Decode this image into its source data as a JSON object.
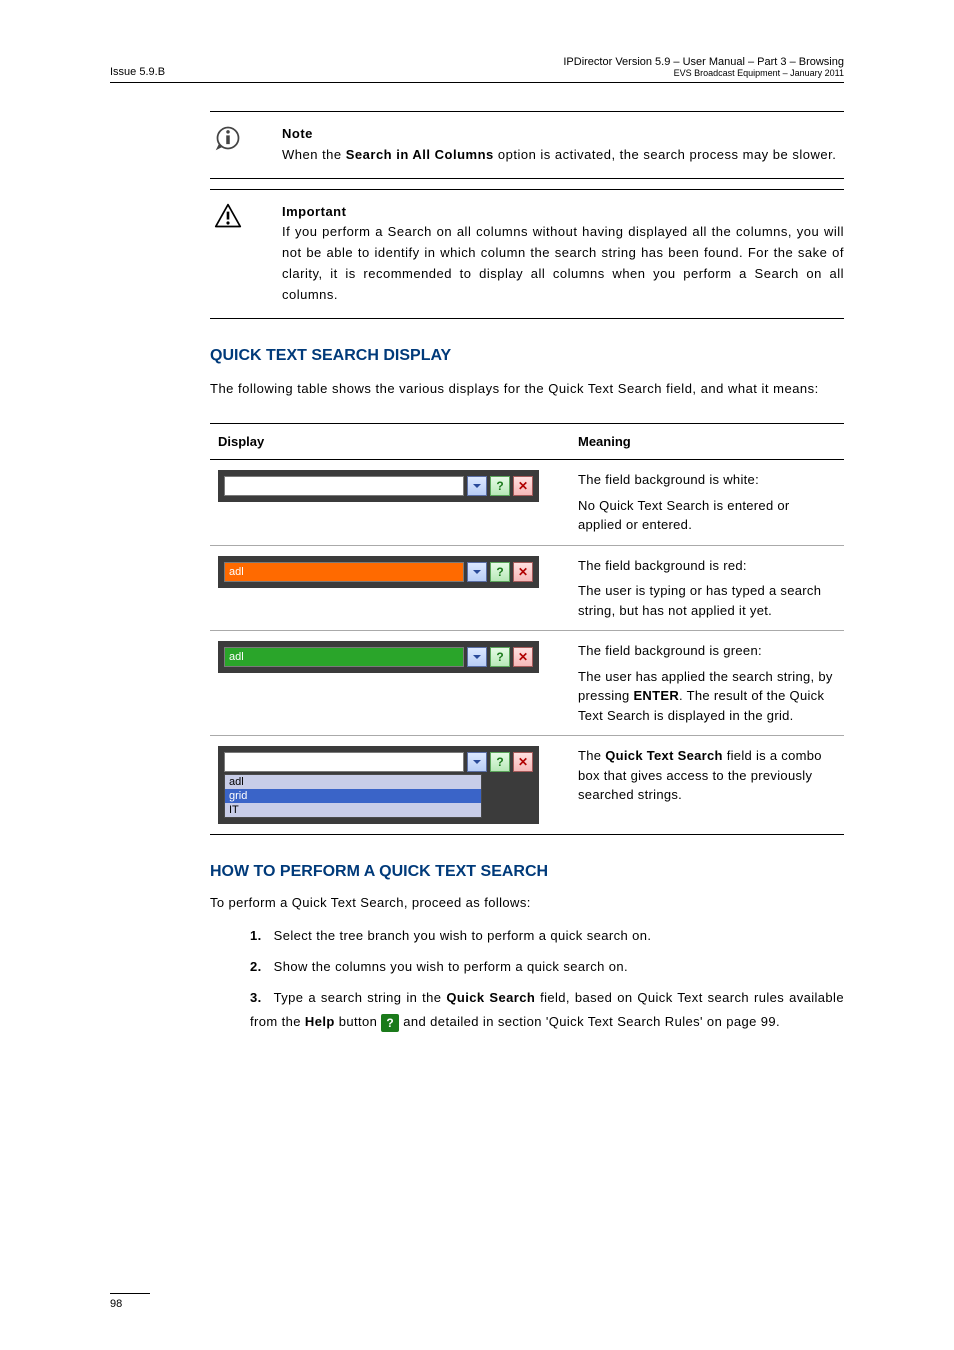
{
  "header": {
    "left": "Issue 5.9.B",
    "right_main": "IPDirector Version 5.9 – User Manual – Part 3 – Browsing",
    "right_sub": "EVS Broadcast Equipment – January 2011"
  },
  "note": {
    "title": "Note",
    "text_before": "When the ",
    "bold1": "Search in All Columns",
    "text_after": " option is activated, the search process may be slower."
  },
  "warning": {
    "title": "Important",
    "text": "If you perform a Search on all columns without having displayed all the columns, you will not be able to identify in which column the search string has been found. For the sake of clarity, it is recommended to display all columns when you perform a Search on all columns."
  },
  "section1": {
    "title": "QUICK TEXT SEARCH DISPLAY",
    "intro": "The following table shows the various displays for the Quick Text Search field, and what it means:",
    "table": {
      "headers": {
        "col1": "Display",
        "col2": "Meaning"
      },
      "rows": [
        {
          "field_bg": "white",
          "field_text": "",
          "show_dropdown": false,
          "meaning_line1": "The field background is white:",
          "meaning_line2": "No Quick Text Search is entered or applied or entered."
        },
        {
          "field_bg": "red",
          "field_text": "adl",
          "show_dropdown": false,
          "meaning_line1": "The field background is red:",
          "meaning_line2": "The user is typing or has typed a search string, but has not applied it yet."
        },
        {
          "field_bg": "green",
          "field_text": "adl",
          "show_dropdown": false,
          "meaning_line1": "The field background is green:",
          "meaning_line2a": "The user has applied the search string, by pressing ",
          "meaning_bold": "ENTER",
          "meaning_line2b": ". The result of the Quick Text Search is displayed in the grid."
        },
        {
          "field_bg": "white",
          "field_text": "",
          "show_dropdown": true,
          "dropdown_items": [
            "adl",
            "grid",
            "IT"
          ],
          "meaning_line1a": "The ",
          "meaning_bold": "Quick Text Search",
          "meaning_line1b": " field is a combo box that gives access to the previously searched strings."
        }
      ]
    }
  },
  "section2": {
    "title": "HOW TO PERFORM A QUICK TEXT SEARCH",
    "lead": "To perform a Quick Text Search, proceed as follows:",
    "steps": {
      "s1_num": "1.",
      "s1": "Select the tree branch you wish to perform a quick search on.",
      "s2_num": "2.",
      "s2": "Show the columns you wish to perform a quick search on.",
      "s3_num": "3.",
      "s3a": "Type a search string in the ",
      "s3_bold1": "Quick Search",
      "s3b": " field, based on Quick Text search rules available from the ",
      "s3_bold2": "Help",
      "s3c": " button ",
      "s3d": " and detailed in section 'Quick Text Search Rules' on page 99."
    }
  },
  "footer": {
    "page": "98"
  }
}
